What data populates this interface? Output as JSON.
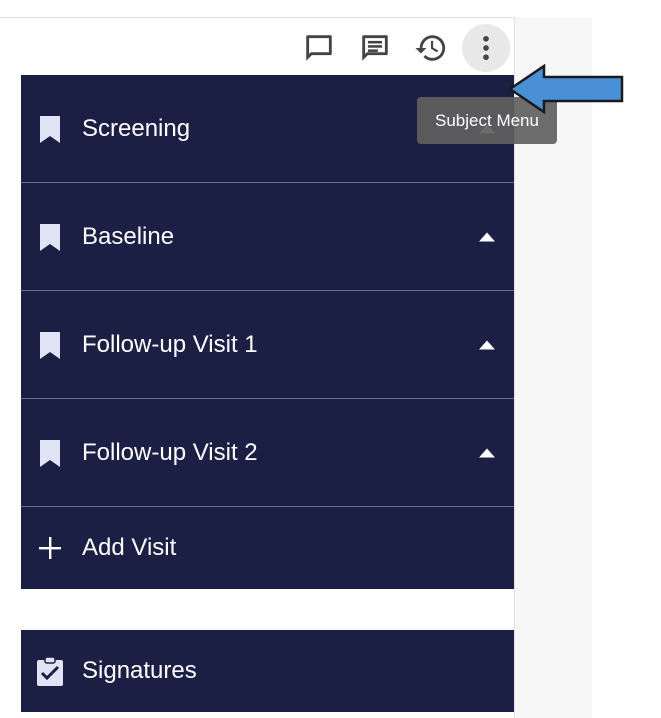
{
  "toolbar": {
    "icons": [
      "comment-icon",
      "notes-icon",
      "history-icon",
      "more-vert-icon"
    ]
  },
  "visits": [
    {
      "label": "Screening"
    },
    {
      "label": "Baseline"
    },
    {
      "label": "Follow-up Visit 1"
    },
    {
      "label": "Follow-up Visit 2"
    }
  ],
  "add_visit": {
    "label": "Add Visit"
  },
  "signatures": {
    "label": "Signatures"
  },
  "tooltip": {
    "text": "Subject Menu"
  },
  "colors": {
    "sidebar_bg": "#1b1f44",
    "annotation_arrow": "#4a90d9",
    "tooltip_bg": "#5f5f5f"
  }
}
